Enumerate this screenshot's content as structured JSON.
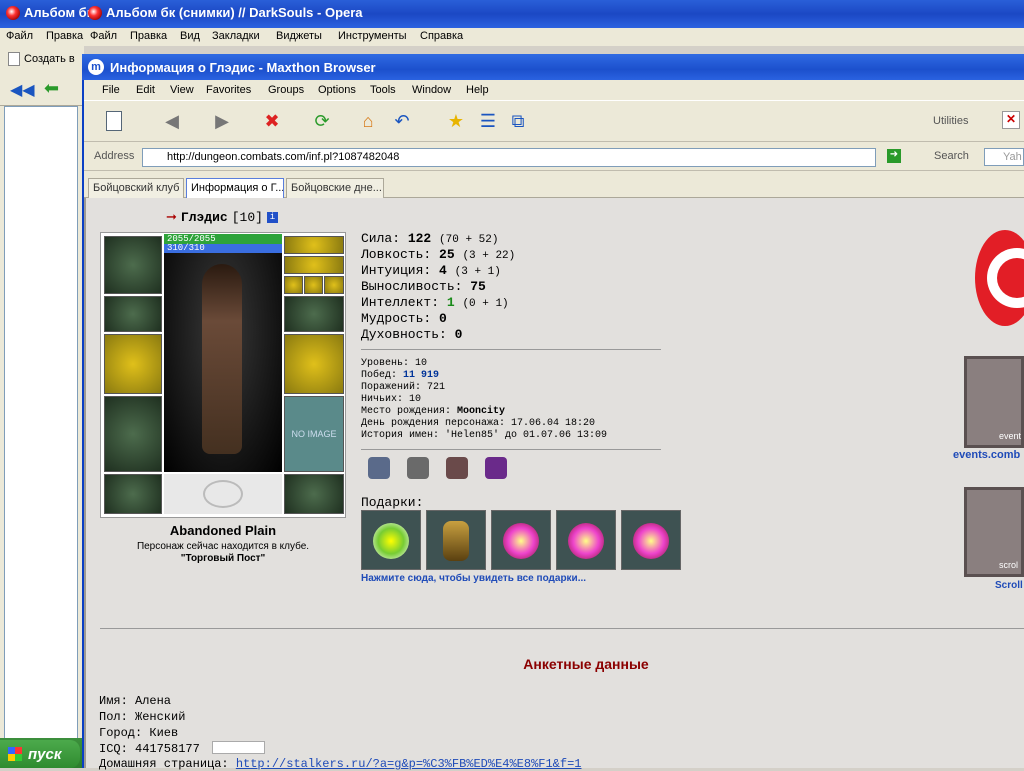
{
  "opera": {
    "tab1": "Альбом бк",
    "tab2": "Альбом бк (снимки) // DarkSouls - Opera",
    "menu": [
      "Файл",
      "Правка",
      "Файл",
      "Правка",
      "Вид",
      "Закладки",
      "Виджеты",
      "Инструменты",
      "Справка"
    ],
    "create_label": "Создать в"
  },
  "taskbar": {
    "start_label": "пуск"
  },
  "maxthon": {
    "title": "Информация о Глэдис - Maxthon Browser",
    "menu": [
      "File",
      "Edit",
      "View",
      "Favorites",
      "Groups",
      "Options",
      "Tools",
      "Window",
      "Help"
    ],
    "utilities_label": "Utilities",
    "address_label": "Address",
    "url": "http://dungeon.combats.com/inf.pl?1087482048",
    "search_label": "Search",
    "search_engine": "Yah",
    "tabs": [
      "Бойцовский клуб",
      "Информация о Г...",
      "Бойцовские дне..."
    ]
  },
  "character": {
    "name": "Глэдис",
    "level": "[10]",
    "hp": "2055/2055",
    "mana": "310/310",
    "no_image": "NO IMAGE",
    "location": "Abandoned Plain",
    "status_line": "Персонаж сейчас находится в клубе.",
    "room": "\"Торговый Пост\""
  },
  "stats": [
    {
      "label": "Сила:",
      "value": "122",
      "extra": "(70 + 52)"
    },
    {
      "label": "Ловкость:",
      "value": "25",
      "extra": "(3 + 22)"
    },
    {
      "label": "Интуиция:",
      "value": "4",
      "extra": "(3 + 1)"
    },
    {
      "label": "Выносливость:",
      "value": "75",
      "extra": ""
    },
    {
      "label": "Интеллект:",
      "value": "1",
      "extra": "(0 + 1)"
    },
    {
      "label": "Мудрость:",
      "value": "0",
      "extra": ""
    },
    {
      "label": "Духовность:",
      "value": "0",
      "extra": ""
    }
  ],
  "info": {
    "level": "Уровень: 10",
    "wins_label": "Побед:",
    "wins_value": "11 919",
    "losses": "Поражений: 721",
    "draws": "Ничьих: 10",
    "birthplace_label": "Место рождения:",
    "birthplace_value": "Mooncity",
    "birthday": "День рождения персонажа: 17.06.04 18:20",
    "name_history": "История имен: 'Helen85' до 01.07.06 13:09"
  },
  "gifts": {
    "label": "Подарки:",
    "link": "Нажмите сюда, чтобы увидеть все подарки..."
  },
  "right_panel": {
    "events_link": "events.comb",
    "event_label": "event",
    "scroll_label": "scrol",
    "scroll_link": "Scroll"
  },
  "profile": {
    "heading": "Анкетные данные",
    "name": "Имя: Алена",
    "gender": "Пол: Женский",
    "city": "Город: Киев",
    "icq": "ICQ: 441758177",
    "homepage_label": "Домашняя страница:",
    "homepage_url": "http://stalkers.ru/?a=g&p=%C3%FB%ED%E4%E8%F1&f=1"
  },
  "colors": {
    "link": "#1f4bb8",
    "heading": "#8b0000",
    "hp_bar": "#2ea33a",
    "mana_bar": "#3a6ee0",
    "win_blue": "#003399",
    "int_green": "#1a8a1a"
  }
}
